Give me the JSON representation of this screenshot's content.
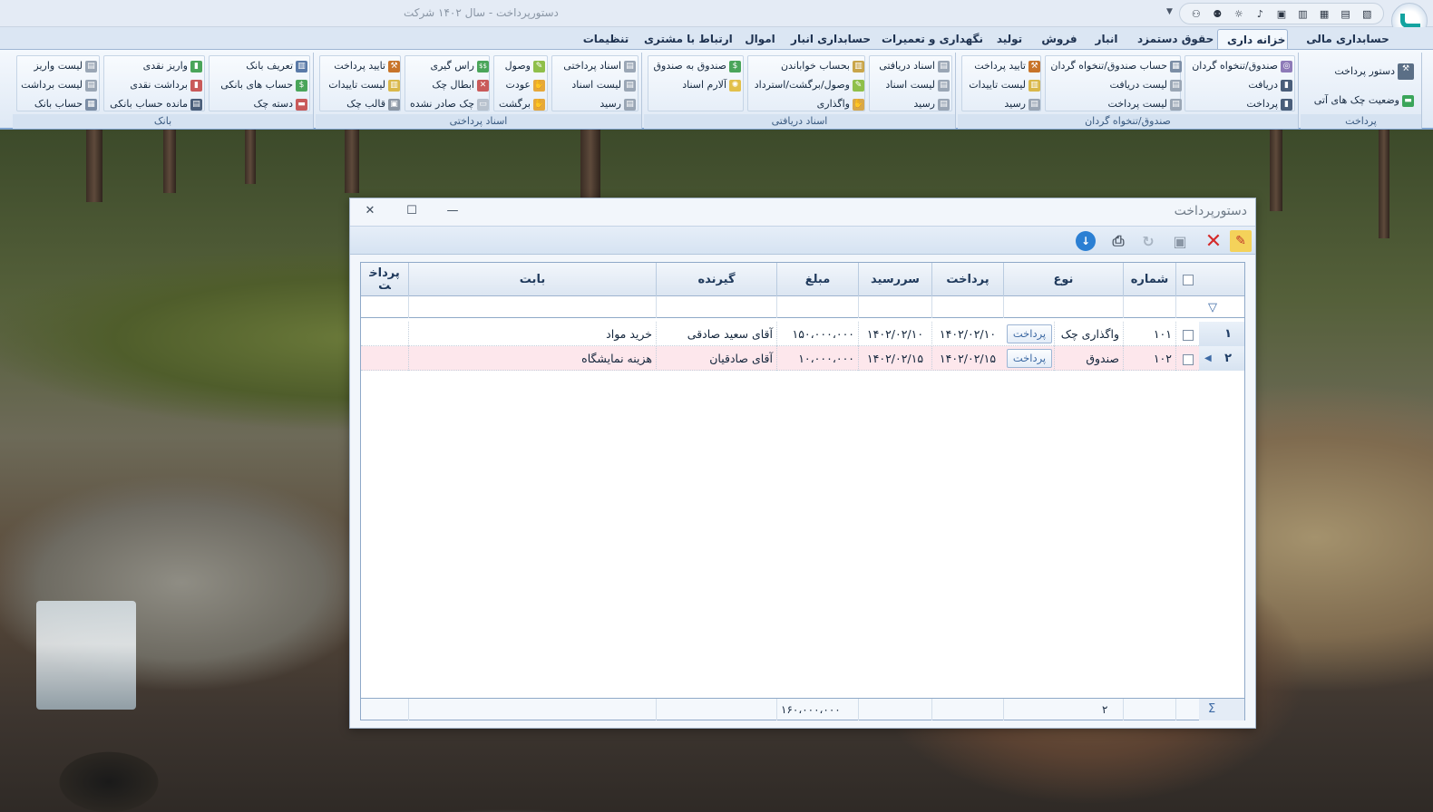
{
  "app": {
    "title": "دستورپرداخت - سال ۱۴۰۲ شرکت"
  },
  "tabs": [
    {
      "label": "حسابداری مالی"
    },
    {
      "label": "خزانه داری"
    },
    {
      "label": "حقوق دستمزد"
    },
    {
      "label": "انبار"
    },
    {
      "label": "فروش"
    },
    {
      "label": "تولید"
    },
    {
      "label": "نگهداری و تعمیرات"
    },
    {
      "label": "حسابداری انبار"
    },
    {
      "label": "اموال"
    },
    {
      "label": "ارتباط با مشتری"
    },
    {
      "label": "تنظیمات"
    }
  ],
  "ribbon": {
    "payment": {
      "label": "پرداخت",
      "items": [
        "دستور پرداخت",
        "وضعیت چک های آتی"
      ]
    },
    "cashbox": {
      "label": "صندوق/تنخواه گردان",
      "col1": [
        "صندوق/تنخواه گردان",
        "دریافت",
        "پرداخت"
      ],
      "col2": [
        "حساب صندوق/تنخواه گردان",
        "لیست دریافت",
        "لیست پرداخت"
      ],
      "col3": [
        "تایید پرداخت",
        "لیست تاییدات",
        "رسید"
      ]
    },
    "received_docs": {
      "label": "اسناد دریافتی",
      "col1": [
        "اسناد دریافتی",
        "لیست اسناد",
        "رسید"
      ],
      "col2": [
        "بحساب خواباندن",
        "وصول/برگشت/استرداد",
        "واگذاری"
      ],
      "col3": [
        "صندوق به صندوق",
        "آلارم اسناد"
      ]
    },
    "payment_docs": {
      "label": "اسناد پرداختی",
      "col1": [
        "اسناد پرداختی",
        "لیست اسناد",
        "رسید"
      ],
      "col2": [
        "وصول",
        "عودت",
        "برگشت"
      ],
      "col3": [
        "راس گیری",
        "ابطال چک",
        "چک صادر نشده"
      ],
      "col4": [
        "تایید پرداخت",
        "لیست تاییدات",
        "قالب چک"
      ]
    },
    "bank": {
      "label": "بانک",
      "col1": [
        "تعریف بانک",
        "حساب های بانکی",
        "دسته چک"
      ],
      "col2": [
        "واریز نقدی",
        "برداشت نقدی",
        "مانده حساب بانکی"
      ],
      "col3": [
        "لیست واریز",
        "لیست برداشت",
        "حساب بانک"
      ]
    }
  },
  "dialog": {
    "title": "دستورپرداخت",
    "columns": {
      "number": "شماره",
      "type": "نوع",
      "payment": "پرداخت",
      "due": "سررسید",
      "amount": "مبلغ",
      "payee": "گیرنده",
      "regarding": "بابت",
      "paid": "پرداخت"
    },
    "rows": [
      {
        "idx": "۱",
        "number": "۱۰۱",
        "type": "واگذاری چک",
        "button": "پرداخت",
        "payment": "۱۴۰۲/۰۲/۱۰",
        "due": "۱۴۰۲/۰۲/۱۰",
        "amount": "۱۵۰،۰۰۰،۰۰۰",
        "payee": "آقای سعید صادقی",
        "regarding": "خرید مواد"
      },
      {
        "idx": "۲",
        "number": "۱۰۲",
        "type": "صندوق",
        "button": "پرداخت",
        "payment": "۱۴۰۲/۰۲/۱۵",
        "due": "۱۴۰۲/۰۲/۱۵",
        "amount": "۱۰،۰۰۰،۰۰۰",
        "payee": "آقای صادقیان",
        "regarding": "هزینه نمایشگاه"
      }
    ],
    "footer": {
      "count": "۲",
      "total": "۱۶۰،۰۰۰،۰۰۰",
      "sigma": "Σ"
    }
  }
}
